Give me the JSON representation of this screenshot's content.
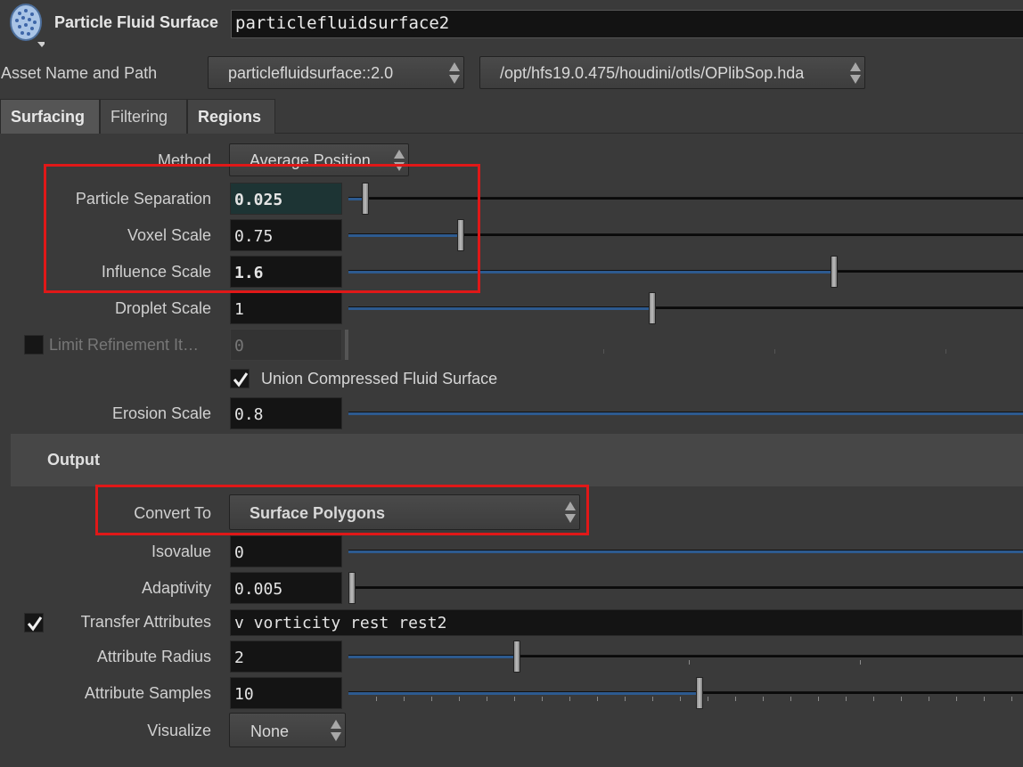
{
  "header": {
    "node_type_label": "Particle Fluid Surface",
    "node_name": "particlefluidsurface2"
  },
  "asset": {
    "label": "Asset Name and Path",
    "name": "particlefluidsurface::2.0",
    "path": "/opt/hfs19.0.475/houdini/otls/OPlibSop.hda"
  },
  "tabs": [
    {
      "label": "Surfacing",
      "active": true
    },
    {
      "label": "Filtering",
      "active": false
    },
    {
      "label": "Regions",
      "active": false
    }
  ],
  "surfacing": {
    "method": {
      "label": "Method",
      "value": "Average Position"
    },
    "particle_separation": {
      "label": "Particle Separation",
      "value": "0.025",
      "fraction": 0.025
    },
    "voxel_scale": {
      "label": "Voxel Scale",
      "value": "0.75",
      "fraction": 0.167
    },
    "influence_scale": {
      "label": "Influence Scale",
      "value": "1.6",
      "fraction": 0.72
    },
    "droplet_scale": {
      "label": "Droplet Scale",
      "value": "1",
      "fraction": 0.45
    },
    "limit_refinement": {
      "label": "Limit Refinement It…",
      "value": "0",
      "checked": false,
      "enabled": false
    },
    "union_compressed": {
      "label": "Union Compressed Fluid Surface",
      "checked": true
    },
    "erosion_scale": {
      "label": "Erosion Scale",
      "value": "0.8",
      "fraction": 1.0
    }
  },
  "output": {
    "section_label": "Output",
    "convert_to": {
      "label": "Convert To",
      "value": "Surface Polygons"
    },
    "isovalue": {
      "label": "Isovalue",
      "value": "0",
      "fraction": 1.0
    },
    "adaptivity": {
      "label": "Adaptivity",
      "value": "0.005",
      "fraction": 0.005
    },
    "transfer_attributes": {
      "label": "Transfer Attributes",
      "value": "v vorticity rest rest2",
      "checked": true
    },
    "attribute_radius": {
      "label": "Attribute Radius",
      "value": "2",
      "fraction": 0.25
    },
    "attribute_samples": {
      "label": "Attribute Samples",
      "value": "10",
      "fraction": 0.52
    },
    "visualize": {
      "label": "Visualize",
      "value": "None"
    }
  },
  "colors": {
    "highlight_box": "#e01818",
    "slider_fill": "#2d5a8f",
    "background": "#3a3a3a"
  },
  "icons": {
    "node": "particle-fluid-node-icon",
    "spinner": "up-down-spinner-icon",
    "check": "checkmark-icon"
  }
}
